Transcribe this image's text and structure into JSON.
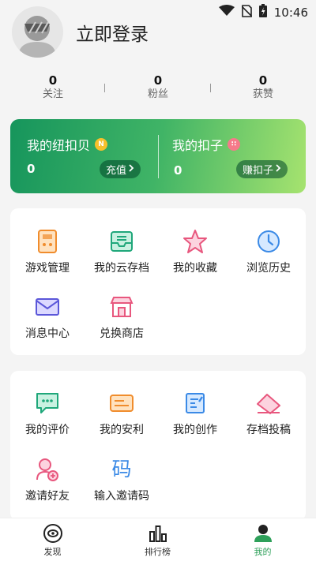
{
  "status_bar": {
    "time": "10:46",
    "icons": [
      "wifi-icon",
      "no-sim-icon",
      "battery-charging-icon"
    ]
  },
  "profile": {
    "login_label": "立即登录"
  },
  "stats": [
    {
      "value": "0",
      "label": "关注"
    },
    {
      "value": "0",
      "label": "粉丝"
    },
    {
      "value": "0",
      "label": "获赞"
    }
  ],
  "wallet": {
    "niukou": {
      "label": "我的纽扣贝",
      "value": "0",
      "button": "充值"
    },
    "kouzi": {
      "label": "我的扣子",
      "value": "0",
      "button": "赚扣子"
    }
  },
  "card1": {
    "items": [
      {
        "label": "游戏管理",
        "icon": "game-manage-icon"
      },
      {
        "label": "我的云存档",
        "icon": "cloud-save-icon"
      },
      {
        "label": "我的收藏",
        "icon": "star-icon"
      },
      {
        "label": "浏览历史",
        "icon": "clock-icon"
      },
      {
        "label": "消息中心",
        "icon": "mail-icon"
      },
      {
        "label": "兑换商店",
        "icon": "store-icon"
      }
    ]
  },
  "card2": {
    "items": [
      {
        "label": "我的评价",
        "icon": "comment-icon"
      },
      {
        "label": "我的安利",
        "icon": "card-icon"
      },
      {
        "label": "我的创作",
        "icon": "edit-doc-icon"
      },
      {
        "label": "存档投稿",
        "icon": "envelope-icon"
      },
      {
        "label": "邀请好友",
        "icon": "add-user-icon"
      },
      {
        "label": "输入邀请码",
        "icon": "code-char-icon",
        "glyph": "码"
      }
    ]
  },
  "bottom_nav": [
    {
      "label": "发现",
      "icon": "discover-icon"
    },
    {
      "label": "排行榜",
      "icon": "ranking-icon"
    },
    {
      "label": "我的",
      "icon": "profile-icon",
      "active": true
    }
  ],
  "colors": {
    "accent": "#2ea05a",
    "wallet_start": "#16955c",
    "wallet_end": "#a6e36f"
  }
}
